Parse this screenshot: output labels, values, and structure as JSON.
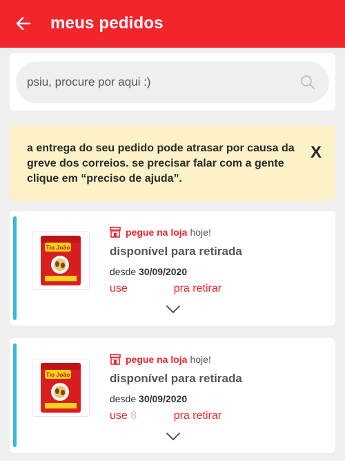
{
  "header": {
    "title": "meus pedidos",
    "back_icon": "arrow-left-icon"
  },
  "search": {
    "placeholder": "psiu, procure por aqui :)",
    "icon": "search-icon"
  },
  "notice": {
    "text": "a entrega do seu pedido pode atrasar por causa da greve dos correios. se precisar falar com a gente clique em “preciso de ajuda”.",
    "close_label": "X"
  },
  "orders": [
    {
      "product_brand": "Tio João",
      "store_label": "pegue na loja",
      "store_suffix": "hoje!",
      "status": "disponível para retirada",
      "date_prefix": "desde",
      "date": "30/09/2020",
      "code_prefix": "use",
      "code_masked": "",
      "code_suffix": "pra retirar"
    },
    {
      "product_brand": "Tio João",
      "store_label": "pegue na loja",
      "store_suffix": "hoje!",
      "status": "disponível para retirada",
      "date_prefix": "desde",
      "date": "30/09/2020",
      "code_prefix": "use",
      "code_masked": "8",
      "code_suffix": "pra retirar"
    }
  ],
  "colors": {
    "brand_red": "#f2242c",
    "accent_blue": "#35b7e3",
    "notice_bg": "#fdf1c7"
  }
}
